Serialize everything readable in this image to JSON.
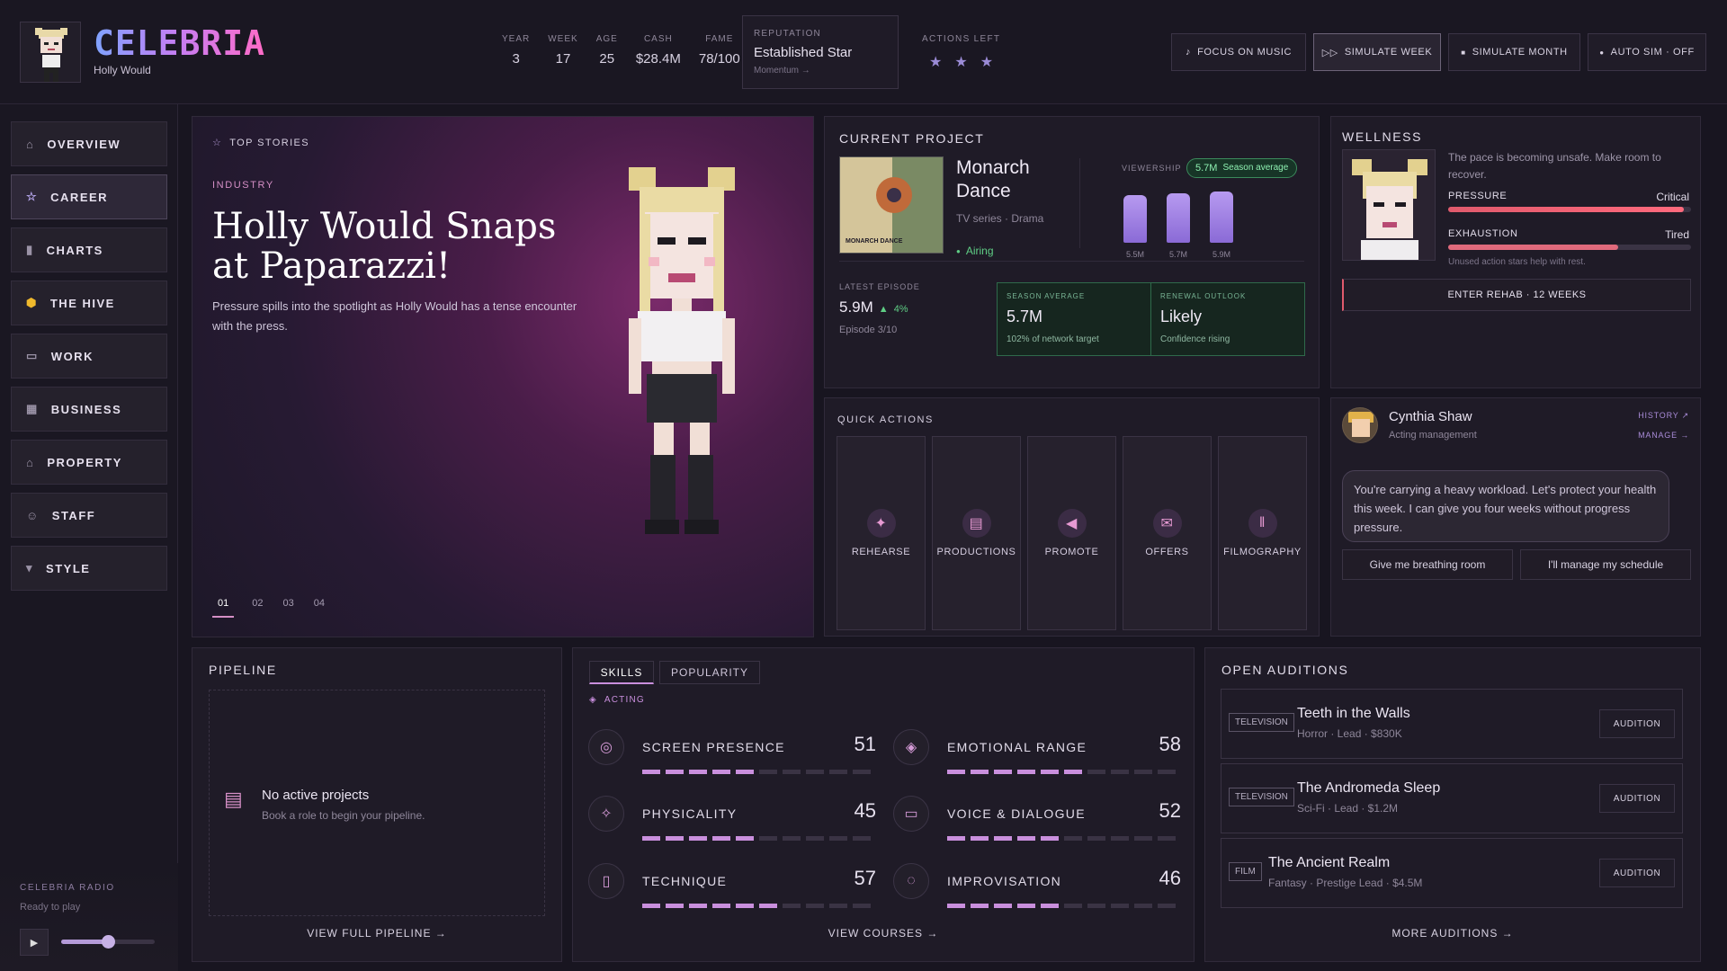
{
  "brand": {
    "logo_text": "CELEBRIA",
    "player_name": "Holly Would"
  },
  "stats": [
    {
      "label": "YEAR",
      "value": "3"
    },
    {
      "label": "WEEK",
      "value": "17"
    },
    {
      "label": "AGE",
      "value": "25"
    },
    {
      "label": "CASH",
      "value": "$28.4M"
    },
    {
      "label": "FAME",
      "value": "78/100"
    }
  ],
  "reputation": {
    "label": "REPUTATION",
    "value": "Established Star",
    "link": "Momentum →"
  },
  "actions_left": {
    "label": "ACTIONS LEFT",
    "count": 3,
    "icon": "star-icon"
  },
  "top_buttons": [
    {
      "label": "FOCUS ON MUSIC",
      "icon": "music-note-icon"
    },
    {
      "label": "SIMULATE WEEK",
      "icon": "fast-forward-icon"
    },
    {
      "label": "SIMULATE MONTH",
      "icon": "square-icon"
    },
    {
      "label": "AUTO SIM · OFF",
      "icon": "dot-icon"
    }
  ],
  "sidebar": {
    "items": [
      {
        "label": "OVERVIEW",
        "icon": "home-icon"
      },
      {
        "label": "CAREER",
        "icon": "star-outline-icon"
      },
      {
        "label": "CHARTS",
        "icon": "bar-chart-icon"
      },
      {
        "label": "THE HIVE",
        "icon": "hive-icon"
      },
      {
        "label": "WORK",
        "icon": "briefcase-icon"
      },
      {
        "label": "BUSINESS",
        "icon": "building-icon"
      },
      {
        "label": "PROPERTY",
        "icon": "bank-icon"
      },
      {
        "label": "STAFF",
        "icon": "people-icon"
      },
      {
        "label": "STYLE",
        "icon": "shirt-icon"
      }
    ]
  },
  "radio": {
    "title": "CELEBRIA RADIO",
    "status": "Ready to play",
    "volume": 0.5
  },
  "story": {
    "section": "TOP STORIES",
    "category": "INDUSTRY",
    "headline": "Holly Would Snaps at Paparazzi!",
    "body": "Pressure spills into the spotlight as Holly Would has a tense encounter with the press.",
    "pages": [
      "01",
      "02",
      "03",
      "04"
    ],
    "active_page": 0
  },
  "project": {
    "section": "CURRENT PROJECT",
    "title": "Monarch Dance",
    "poster_title": "MONARCH DANCE",
    "type": "TV series · Drama",
    "status": "Airing",
    "viewership_label": "VIEWERSHIP",
    "viewership_badge": "5.7M",
    "viewership_badge_note": "Season average",
    "bars": [
      {
        "label": "5.5M",
        "value": 5.5
      },
      {
        "label": "5.7M",
        "value": 5.7
      },
      {
        "label": "5.9M",
        "value": 5.9
      }
    ],
    "latest": {
      "label": "LATEST EPISODE",
      "value": "5.9M",
      "delta": "4%",
      "episode": "Episode 3/10"
    },
    "season": {
      "label": "SEASON AVERAGE",
      "value": "5.7M",
      "note": "102% of network target"
    },
    "renewal": {
      "label": "RENEWAL OUTLOOK",
      "value": "Likely",
      "note": "Confidence rising"
    }
  },
  "wellness": {
    "section": "WELLNESS",
    "message": "The pace is becoming unsafe. Make room to recover.",
    "pressure": {
      "label": "PRESSURE",
      "status": "Critical",
      "level": 0.97
    },
    "exhaustion": {
      "label": "EXHAUSTION",
      "status": "Tired",
      "level": 0.7
    },
    "hint": "Unused action stars help with rest.",
    "rehab_button": "ENTER REHAB · 12 WEEKS"
  },
  "quick_actions": {
    "section": "QUICK ACTIONS",
    "items": [
      {
        "label": "REHEARSE",
        "icon": "sparkle-icon"
      },
      {
        "label": "PRODUCTIONS",
        "icon": "clapperboard-icon"
      },
      {
        "label": "PROMOTE",
        "icon": "megaphone-icon"
      },
      {
        "label": "OFFERS",
        "icon": "mail-icon"
      },
      {
        "label": "FILMOGRAPHY",
        "icon": "library-icon"
      }
    ]
  },
  "manager": {
    "name": "Cynthia Shaw",
    "role": "Acting management",
    "history": "HISTORY ↗",
    "manage": "MANAGE →",
    "message": "You're carrying a heavy workload. Let's protect your health this week. I can give you four weeks without progress pressure.",
    "option1": "Give me breathing room",
    "option2": "I'll manage my schedule"
  },
  "pipeline": {
    "section": "PIPELINE",
    "empty_title": "No active projects",
    "empty_sub": "Book a role to begin your pipeline.",
    "link": "VIEW FULL PIPELINE →"
  },
  "skills": {
    "tabs": [
      "SKILLS",
      "POPULARITY"
    ],
    "active_tab": 0,
    "category": "ACTING",
    "link": "VIEW COURSES →",
    "items": [
      {
        "label": "SCREEN PRESENCE",
        "value": 51,
        "icon": "aperture-icon"
      },
      {
        "label": "EMOTIONAL RANGE",
        "value": 58,
        "icon": "mask-icon"
      },
      {
        "label": "PHYSICALITY",
        "value": 45,
        "icon": "figure-icon"
      },
      {
        "label": "VOICE & DIALOGUE",
        "value": 52,
        "icon": "speech-bubble-icon"
      },
      {
        "label": "TECHNIQUE",
        "value": 57,
        "icon": "book-icon"
      },
      {
        "label": "IMPROVISATION",
        "value": 46,
        "icon": "lightbulb-icon"
      }
    ]
  },
  "auditions": {
    "section": "OPEN AUDITIONS",
    "link": "MORE AUDITIONS →",
    "items": [
      {
        "tag": "TELEVISION",
        "title": "Teeth in the Walls",
        "sub": "Horror · Lead · $830K",
        "button": "AUDITION"
      },
      {
        "tag": "TELEVISION",
        "title": "The Andromeda Sleep",
        "sub": "Sci-Fi · Lead · $1.2M",
        "button": "AUDITION"
      },
      {
        "tag": "FILM",
        "title": "The Ancient Realm",
        "sub": "Fantasy · Prestige Lead · $4.5M",
        "button": "AUDITION"
      }
    ]
  }
}
